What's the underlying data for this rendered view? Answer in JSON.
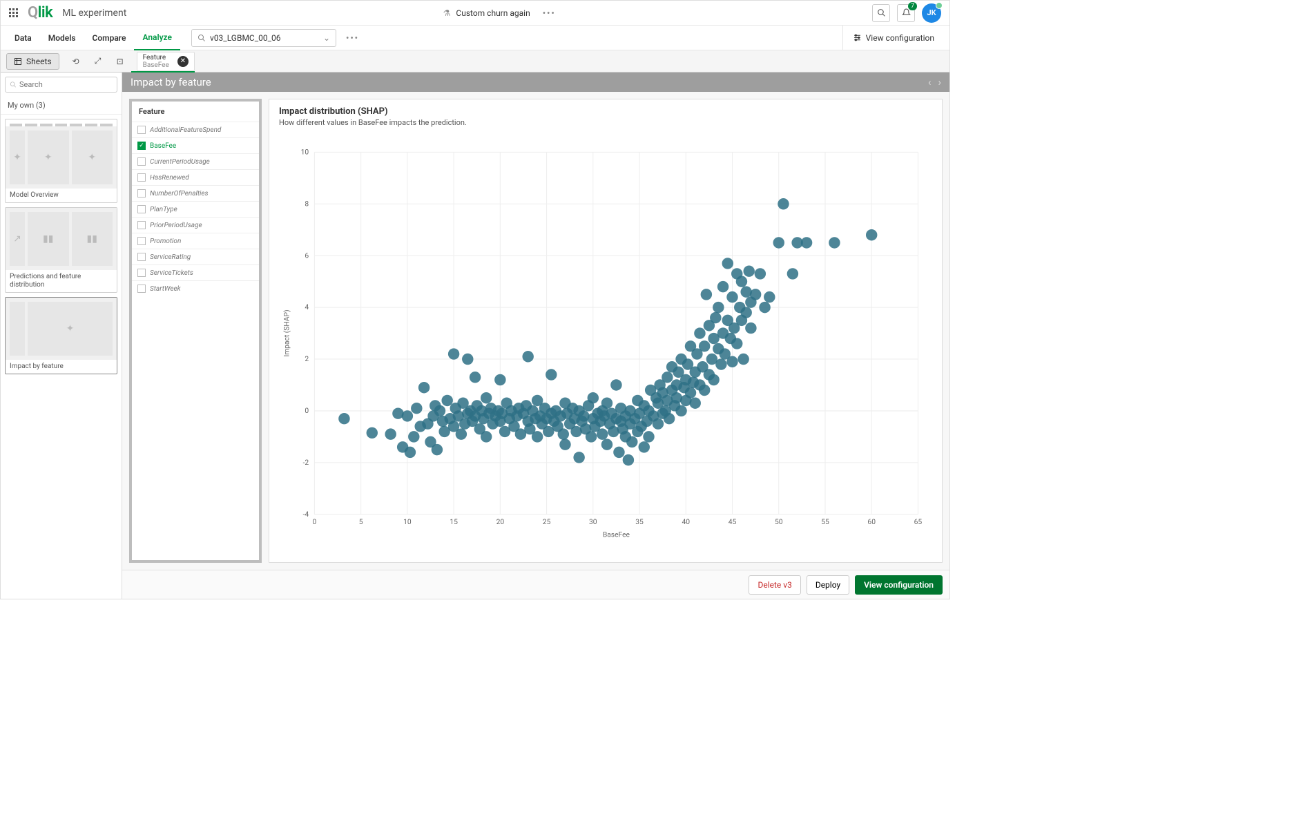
{
  "header": {
    "app_title": "ML experiment",
    "project_name": "Custom churn again"
  },
  "user": {
    "initials": "JK",
    "notification_count": "7"
  },
  "nav": {
    "items": [
      "Data",
      "Models",
      "Compare",
      "Analyze"
    ],
    "active": "Analyze",
    "model_selected": "v03_LGBMC_00_06",
    "view_configuration": "View configuration"
  },
  "toolbar": {
    "sheets_label": "Sheets",
    "chip_title": "Feature",
    "chip_value": "BaseFee"
  },
  "sidebar": {
    "search_placeholder": "Search",
    "my_own": "My own (3)",
    "sheets": [
      {
        "label": "Model Overview"
      },
      {
        "label": "Predictions and feature distribution"
      },
      {
        "label": "Impact by feature",
        "active": true
      }
    ]
  },
  "page": {
    "title": "Impact by feature"
  },
  "feature_panel": {
    "title": "Feature",
    "items": [
      {
        "name": "AdditionalFeatureSpend",
        "checked": false
      },
      {
        "name": "BaseFee",
        "checked": true
      },
      {
        "name": "CurrentPeriodUsage",
        "checked": false
      },
      {
        "name": "HasRenewed",
        "checked": false
      },
      {
        "name": "NumberOfPenalties",
        "checked": false
      },
      {
        "name": "PlanType",
        "checked": false
      },
      {
        "name": "PriorPeriodUsage",
        "checked": false
      },
      {
        "name": "Promotion",
        "checked": false
      },
      {
        "name": "ServiceRating",
        "checked": false
      },
      {
        "name": "ServiceTickets",
        "checked": false
      },
      {
        "name": "StartWeek",
        "checked": false
      }
    ]
  },
  "chart_panel": {
    "title": "Impact distribution (SHAP)",
    "subtitle": "How different values in BaseFee impacts the prediction."
  },
  "chart_data": {
    "type": "scatter",
    "xlabel": "BaseFee",
    "ylabel": "Impact (SHAP)",
    "xlim": [
      0,
      65
    ],
    "ylim": [
      -4,
      10
    ],
    "xticks": [
      0,
      5,
      10,
      15,
      20,
      25,
      30,
      35,
      40,
      45,
      50,
      55,
      60,
      65
    ],
    "yticks": [
      -4,
      -2,
      0,
      2,
      4,
      6,
      8,
      10
    ],
    "points": [
      [
        3.2,
        -0.3
      ],
      [
        6.2,
        -0.85
      ],
      [
        8.2,
        -0.9
      ],
      [
        9.0,
        -0.1
      ],
      [
        9.5,
        -1.4
      ],
      [
        10.0,
        -0.2
      ],
      [
        10.3,
        -1.6
      ],
      [
        10.7,
        -1.0
      ],
      [
        11.0,
        0.1
      ],
      [
        11.4,
        -0.6
      ],
      [
        11.8,
        0.9
      ],
      [
        12.2,
        -0.5
      ],
      [
        12.5,
        -1.2
      ],
      [
        12.8,
        -0.2
      ],
      [
        13.0,
        0.2
      ],
      [
        13.2,
        -1.5
      ],
      [
        13.5,
        0.0
      ],
      [
        13.8,
        -0.4
      ],
      [
        14.0,
        -0.8
      ],
      [
        14.3,
        0.4
      ],
      [
        14.6,
        -0.3
      ],
      [
        15.0,
        2.2
      ],
      [
        15.0,
        -0.6
      ],
      [
        15.2,
        0.1
      ],
      [
        15.5,
        -0.2
      ],
      [
        15.8,
        -0.9
      ],
      [
        16.0,
        0.3
      ],
      [
        16.2,
        -0.5
      ],
      [
        16.5,
        2.0
      ],
      [
        16.5,
        -0.1
      ],
      [
        16.8,
        0.0
      ],
      [
        17.0,
        -0.4
      ],
      [
        17.3,
        1.3
      ],
      [
        17.3,
        -0.2
      ],
      [
        17.5,
        0.2
      ],
      [
        17.8,
        -0.7
      ],
      [
        18.0,
        0.0
      ],
      [
        18.2,
        -0.3
      ],
      [
        18.5,
        -1.0
      ],
      [
        18.5,
        0.5
      ],
      [
        18.8,
        -0.1
      ],
      [
        19.0,
        0.1
      ],
      [
        19.2,
        -0.5
      ],
      [
        19.5,
        -0.2
      ],
      [
        19.8,
        0.0
      ],
      [
        20.0,
        1.2
      ],
      [
        20.0,
        -0.4
      ],
      [
        20.2,
        -0.1
      ],
      [
        20.5,
        -0.8
      ],
      [
        20.7,
        0.3
      ],
      [
        21.0,
        -0.3
      ],
      [
        21.2,
        0.0
      ],
      [
        21.5,
        -0.6
      ],
      [
        21.8,
        -0.2
      ],
      [
        22.0,
        0.1
      ],
      [
        22.2,
        -0.9
      ],
      [
        22.5,
        -0.1
      ],
      [
        22.8,
        0.2
      ],
      [
        23.0,
        -0.4
      ],
      [
        23.0,
        2.1
      ],
      [
        23.2,
        -0.7
      ],
      [
        23.5,
        0.0
      ],
      [
        23.8,
        -0.3
      ],
      [
        24.0,
        -1.0
      ],
      [
        24.0,
        0.4
      ],
      [
        24.3,
        -0.2
      ],
      [
        24.5,
        -0.5
      ],
      [
        24.8,
        0.1
      ],
      [
        25.0,
        -0.3
      ],
      [
        25.2,
        -0.8
      ],
      [
        25.5,
        1.4
      ],
      [
        25.5,
        -0.1
      ],
      [
        25.8,
        -0.4
      ],
      [
        26.0,
        0.0
      ],
      [
        26.2,
        -0.6
      ],
      [
        26.5,
        -0.2
      ],
      [
        26.8,
        -0.9
      ],
      [
        27.0,
        0.3
      ],
      [
        27.0,
        -1.3
      ],
      [
        27.2,
        -0.1
      ],
      [
        27.5,
        -0.5
      ],
      [
        27.8,
        0.1
      ],
      [
        28.0,
        -0.3
      ],
      [
        28.2,
        -0.8
      ],
      [
        28.5,
        -1.8
      ],
      [
        28.5,
        0.0
      ],
      [
        28.8,
        -0.4
      ],
      [
        29.0,
        -0.2
      ],
      [
        29.2,
        -0.7
      ],
      [
        29.5,
        0.2
      ],
      [
        29.8,
        -1.0
      ],
      [
        30.0,
        -0.3
      ],
      [
        30.0,
        0.5
      ],
      [
        30.2,
        -0.6
      ],
      [
        30.5,
        -0.1
      ],
      [
        30.8,
        -0.4
      ],
      [
        31.0,
        -0.9
      ],
      [
        31.0,
        0.0
      ],
      [
        31.2,
        -0.2
      ],
      [
        31.5,
        -1.3
      ],
      [
        31.5,
        0.3
      ],
      [
        31.8,
        -0.5
      ],
      [
        32.0,
        -0.1
      ],
      [
        32.2,
        -0.8
      ],
      [
        32.5,
        -0.3
      ],
      [
        32.5,
        1.0
      ],
      [
        32.8,
        -1.6
      ],
      [
        33.0,
        -0.4
      ],
      [
        33.0,
        0.1
      ],
      [
        33.2,
        -0.7
      ],
      [
        33.5,
        -1.0
      ],
      [
        33.5,
        -0.2
      ],
      [
        33.8,
        -1.9
      ],
      [
        34.0,
        0.0
      ],
      [
        34.0,
        -0.5
      ],
      [
        34.2,
        -1.2
      ],
      [
        34.5,
        -0.3
      ],
      [
        34.8,
        -0.8
      ],
      [
        34.8,
        0.4
      ],
      [
        35.0,
        -0.1
      ],
      [
        35.2,
        -0.6
      ],
      [
        35.5,
        -1.4
      ],
      [
        35.5,
        0.2
      ],
      [
        35.8,
        -0.4
      ],
      [
        36.0,
        0.0
      ],
      [
        36.0,
        -1.0
      ],
      [
        36.2,
        0.8
      ],
      [
        36.5,
        -0.2
      ],
      [
        36.8,
        0.5
      ],
      [
        37.0,
        -0.5
      ],
      [
        37.0,
        0.3
      ],
      [
        37.2,
        1.0
      ],
      [
        37.5,
        -0.1
      ],
      [
        37.5,
        0.7
      ],
      [
        37.8,
        0.0
      ],
      [
        38.0,
        0.4
      ],
      [
        38.0,
        1.3
      ],
      [
        38.2,
        -0.3
      ],
      [
        38.5,
        1.7
      ],
      [
        38.5,
        0.8
      ],
      [
        38.8,
        0.2
      ],
      [
        39.0,
        1.0
      ],
      [
        39.0,
        0.5
      ],
      [
        39.2,
        1.5
      ],
      [
        39.5,
        0.0
      ],
      [
        39.5,
        2.0
      ],
      [
        39.8,
        0.9
      ],
      [
        40.0,
        1.2
      ],
      [
        40.0,
        0.4
      ],
      [
        40.2,
        1.8
      ],
      [
        40.5,
        0.7
      ],
      [
        40.5,
        2.5
      ],
      [
        40.8,
        1.1
      ],
      [
        41.0,
        1.5
      ],
      [
        41.0,
        0.3
      ],
      [
        41.2,
        2.2
      ],
      [
        41.5,
        1.0
      ],
      [
        41.5,
        3.0
      ],
      [
        41.8,
        1.7
      ],
      [
        42.0,
        2.5
      ],
      [
        42.0,
        0.8
      ],
      [
        42.2,
        4.5
      ],
      [
        42.5,
        1.4
      ],
      [
        42.5,
        3.3
      ],
      [
        42.8,
        2.0
      ],
      [
        43.0,
        2.8
      ],
      [
        43.0,
        1.2
      ],
      [
        43.2,
        3.6
      ],
      [
        43.5,
        2.4
      ],
      [
        43.5,
        4.0
      ],
      [
        43.8,
        1.8
      ],
      [
        44.0,
        4.8
      ],
      [
        44.0,
        3.0
      ],
      [
        44.2,
        2.2
      ],
      [
        44.5,
        3.5
      ],
      [
        44.5,
        5.7
      ],
      [
        44.8,
        2.8
      ],
      [
        45.0,
        4.4
      ],
      [
        45.0,
        1.9
      ],
      [
        45.2,
        3.2
      ],
      [
        45.5,
        5.3
      ],
      [
        45.5,
        2.6
      ],
      [
        45.8,
        4.0
      ],
      [
        46.0,
        3.5
      ],
      [
        46.0,
        5.0
      ],
      [
        46.2,
        2.0
      ],
      [
        46.5,
        4.6
      ],
      [
        46.5,
        3.8
      ],
      [
        46.8,
        5.4
      ],
      [
        47.0,
        3.2
      ],
      [
        47.0,
        4.2
      ],
      [
        47.5,
        4.5
      ],
      [
        48.0,
        5.3
      ],
      [
        48.5,
        4.0
      ],
      [
        49.0,
        4.4
      ],
      [
        50.0,
        6.5
      ],
      [
        50.5,
        8.0
      ],
      [
        51.5,
        5.3
      ],
      [
        52.0,
        6.5
      ],
      [
        53.0,
        6.5
      ],
      [
        56.0,
        6.5
      ],
      [
        60.0,
        6.8
      ]
    ]
  },
  "footer": {
    "delete": "Delete v3",
    "deploy": "Deploy",
    "view_config": "View configuration"
  }
}
